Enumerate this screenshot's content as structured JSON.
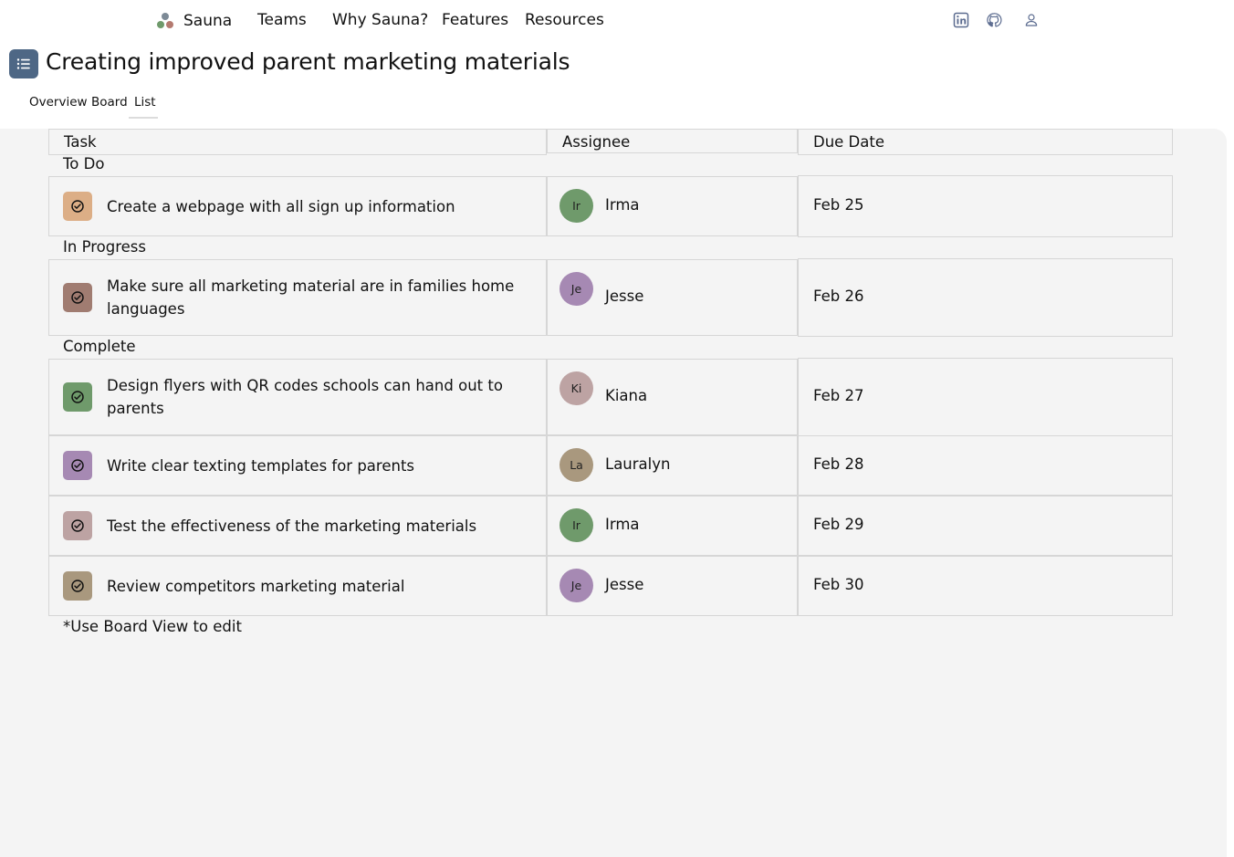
{
  "nav": {
    "brand": "Sauna",
    "items": [
      "Teams",
      "Why Sauna?",
      "Features",
      "Resources"
    ],
    "icons": [
      "linkedin-icon",
      "github-icon",
      "user-icon"
    ]
  },
  "page": {
    "title": "Creating improved parent marketing materials",
    "tabs": [
      "Overview",
      "Board",
      "List"
    ],
    "active_tab": "List"
  },
  "table": {
    "columns": [
      "Task",
      "Assignee",
      "Due Date"
    ],
    "groups": [
      {
        "label": "To Do",
        "rows": [
          {
            "task": "Create a webpage with all sign up information",
            "initials": "Ir",
            "assignee": "Irma",
            "due": "Feb 25",
            "color": "#dcae86",
            "avatar_color": "#6f9a6b"
          }
        ]
      },
      {
        "label": "In Progress",
        "rows": [
          {
            "task": "Make sure all marketing material are in families home languages",
            "initials": "Je",
            "assignee": "Jesse",
            "due": "Feb 26",
            "color": "#a07c71",
            "avatar_color": "#a689b3"
          }
        ]
      },
      {
        "label": "Complete",
        "rows": [
          {
            "task": "Design flyers with QR codes schools can hand out to parents",
            "initials": "Ki",
            "assignee": "Kiana",
            "due": "Feb 27",
            "color": "#6f9a6b",
            "avatar_color": "#bda3a3"
          },
          {
            "task": "Write clear texting templates for parents",
            "initials": "La",
            "assignee": "Lauralyn",
            "due": "Feb 28",
            "color": "#a689b3",
            "avatar_color": "#a9987e"
          },
          {
            "task": "Test the effectiveness of the marketing materials",
            "initials": "Ir",
            "assignee": "Irma",
            "due": "Feb 29",
            "color": "#bda3a3",
            "avatar_color": "#6f9a6b"
          },
          {
            "task": "Review competitors marketing material",
            "initials": "Je",
            "assignee": "Jesse",
            "due": "Feb 30",
            "color": "#a9987e",
            "avatar_color": "#a689b3"
          }
        ]
      }
    ],
    "footnote": "*Use Board View to edit"
  }
}
